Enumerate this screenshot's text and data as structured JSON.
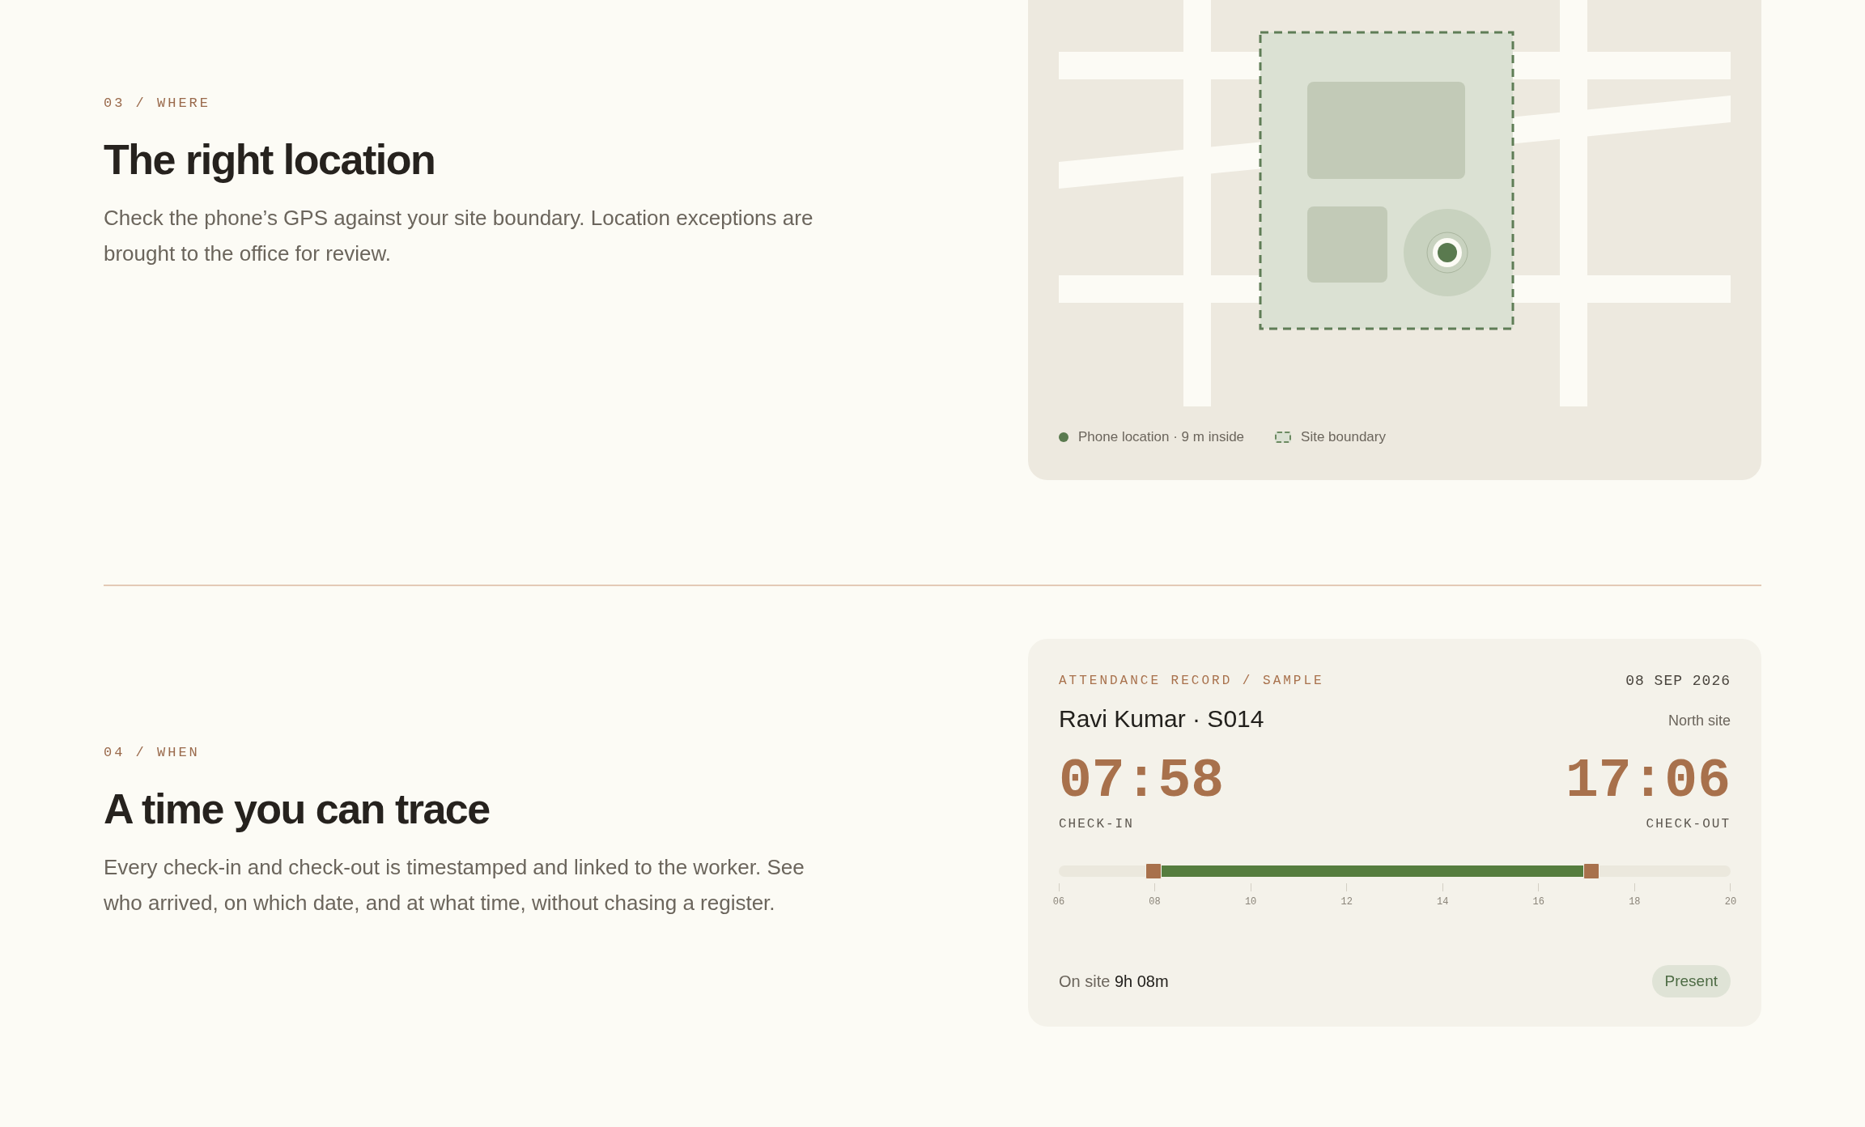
{
  "sections": [
    {
      "kind": "map",
      "eyebrow": "03 / WHERE",
      "heading": "The right location",
      "body": "Check the phone’s GPS against your site boundary. Location exceptions are brought to the office for review.",
      "legend": [
        {
          "kind": "dot",
          "label": "Phone location · 9 m inside"
        },
        {
          "kind": "boundary",
          "label": "Site boundary"
        }
      ]
    },
    {
      "kind": "record",
      "eyebrow": "04 / WHEN",
      "heading": "A time you can trace",
      "body": "Every check-in and check-out is timestamped and linked to the worker. See who arrived, on which date, and at what time, without chasing a register.",
      "record": {
        "label": "ATTENDANCE RECORD / SAMPLE",
        "date": "08 SEP 2026",
        "worker": "Ravi Kumar · S014",
        "site": "North site",
        "times": [
          {
            "value": "07:58",
            "label": "CHECK-IN"
          },
          {
            "value": "17:06",
            "label": "CHECK-OUT"
          }
        ],
        "handles": [
          {
            "level": 0.1405
          },
          {
            "level": 0.7929
          }
        ],
        "ticks": [
          "06",
          "08",
          "10",
          "12",
          "14",
          "16",
          "18",
          "20"
        ],
        "duration": "On site **9h 08m**",
        "status": "Present"
      }
    }
  ]
}
